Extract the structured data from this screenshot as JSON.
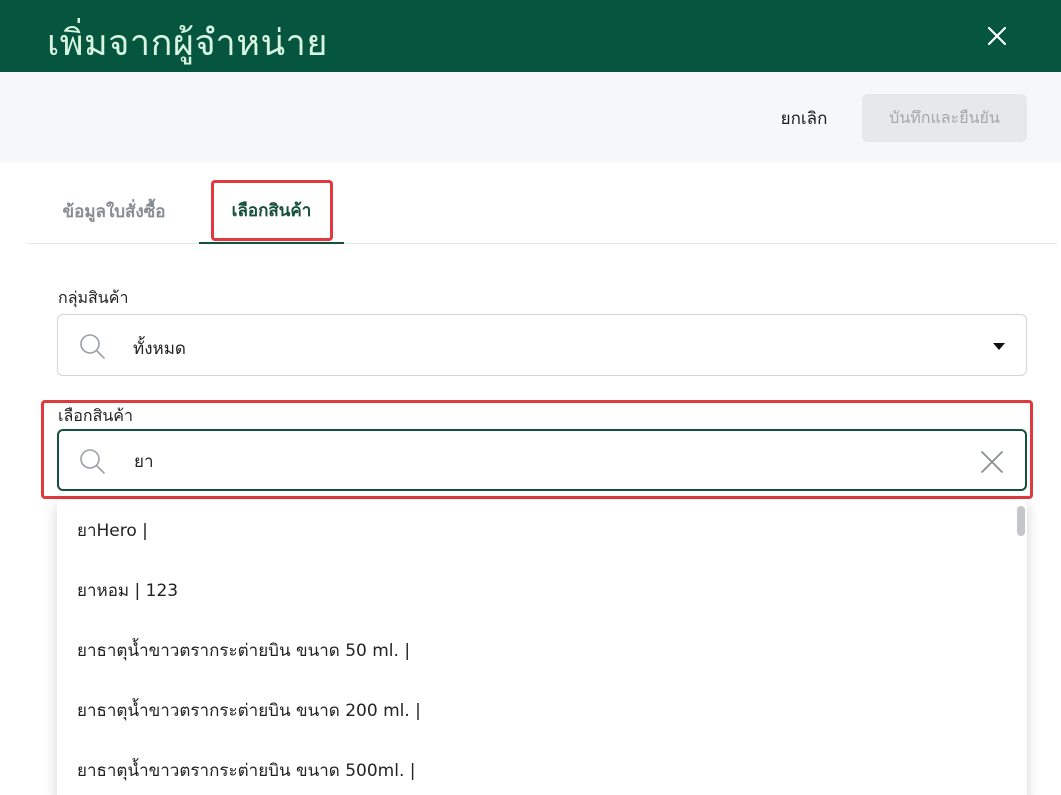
{
  "header": {
    "title": "เพิ่มจากผู้จำหน่าย",
    "close_icon": "close-icon"
  },
  "actions": {
    "cancel_label": "ยกเลิก",
    "save_label": "บันทึกและยืนยัน"
  },
  "tabs": [
    {
      "label": "ข้อมูลใบสั่งซื้อ",
      "active": false
    },
    {
      "label": "เลือกสินค้า",
      "active": true
    }
  ],
  "product_group": {
    "label": "กลุ่มสินค้า",
    "value": "ทั้งหมด"
  },
  "product_search": {
    "label": "เลือกสินค้า",
    "value": "ยา"
  },
  "results": [
    {
      "text": "ยาHero |"
    },
    {
      "text": "ยาหอม | 123"
    },
    {
      "text": "ยาธาตุน้ำขาวตรากระต่ายบิน ขนาด 50 ml. |"
    },
    {
      "text": "ยาธาตุน้ำขาวตรากระต่ายบิน ขนาด 200 ml. |"
    },
    {
      "text": "ยาธาตุน้ำขาวตรากระต่ายบิน ขนาด 500ml. |"
    }
  ],
  "colors": {
    "header_bg": "#05553f",
    "accent": "#17503f",
    "highlight": "#e0393e"
  }
}
